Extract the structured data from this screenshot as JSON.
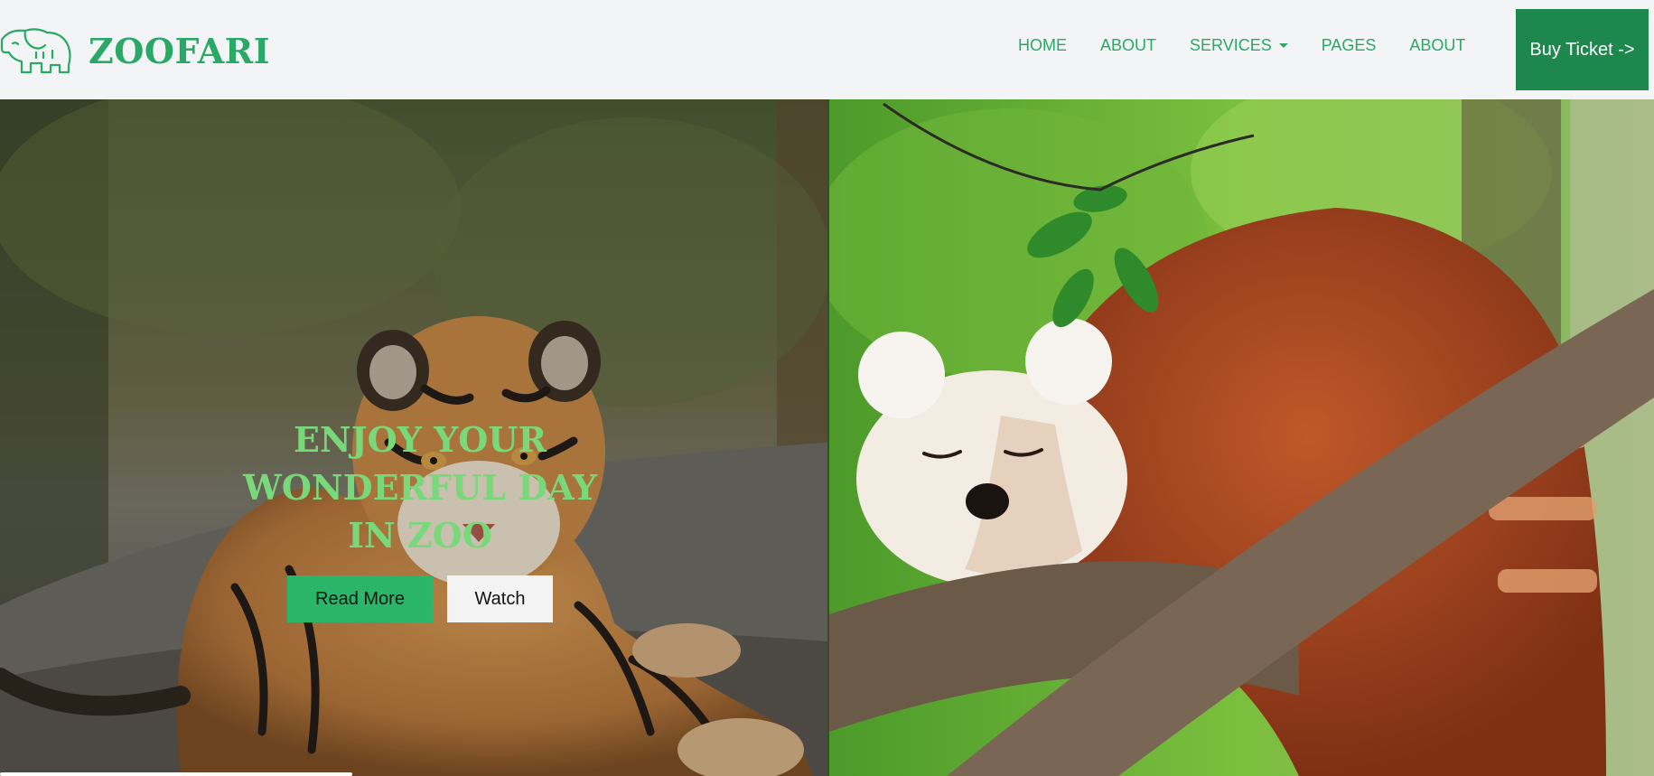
{
  "brand": {
    "name": "ZOOFARI",
    "logo_icon": "elephant-outline-icon",
    "color": "#2aa866"
  },
  "nav": {
    "items": [
      {
        "label": "HOME"
      },
      {
        "label": "ABOUT"
      },
      {
        "label": "SERVICES",
        "has_dropdown": true
      },
      {
        "label": "PAGES"
      },
      {
        "label": "ABOUT"
      }
    ],
    "buy_ticket_label": "Buy Ticket ->",
    "accent": "#1d874d"
  },
  "hero": {
    "title": "ENJOY YOUR WONDERFUL DAY IN ZOO",
    "read_more_label": "Read More",
    "watch_label": "Watch",
    "images": [
      {
        "icon": "tiger-photo"
      },
      {
        "icon": "red-panda-photo"
      }
    ],
    "title_color": "#79d97a"
  }
}
